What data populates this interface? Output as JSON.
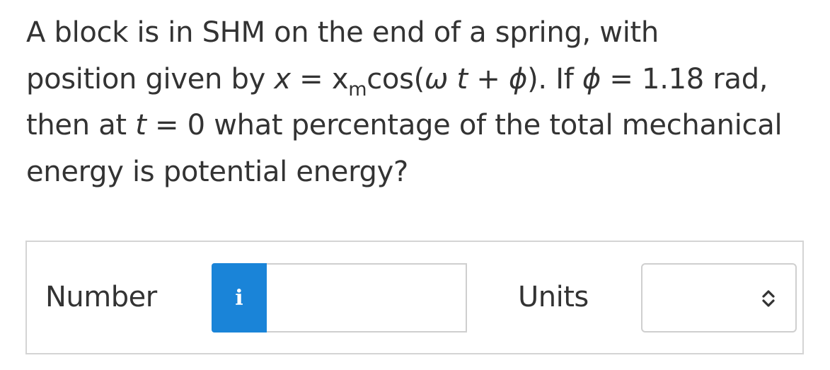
{
  "question": {
    "line1": "A block is in SHM on the end of a spring, with",
    "line2_prefix": "position given by ",
    "var_x": "x",
    "eq1": " = ",
    "var_xm": "x",
    "sub_m": "m",
    "cos_open": "cos(",
    "omega": "ω",
    "space_t": " ",
    "var_t": "t",
    "plus": " + ",
    "phi1": "ϕ",
    "line2_mid": "). If ",
    "phi2": "ϕ",
    "line2_suffix": " = 1.18 rad,",
    "line3_prefix": "then at ",
    "var_t2": "t",
    "line3_suffix": " = 0 what percentage of the total mechanical",
    "line4": "energy is potential energy?"
  },
  "answer": {
    "number_label": "Number",
    "info_button_label": "i",
    "number_value": "",
    "units_label": "Units",
    "units_selected": ""
  }
}
